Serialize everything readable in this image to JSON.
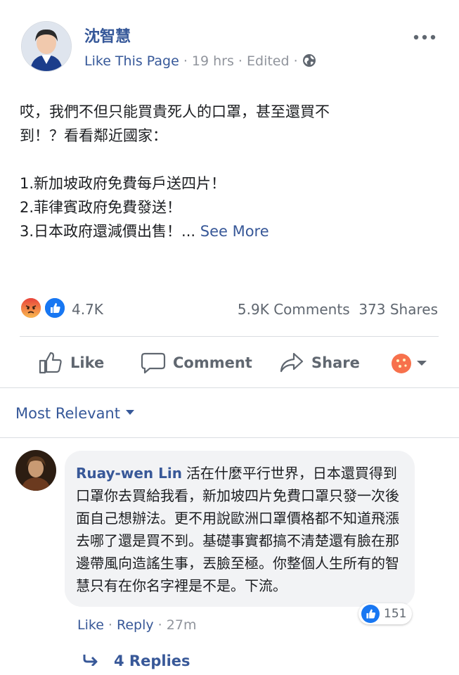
{
  "post": {
    "author": "沈智慧",
    "like_page": "Like This Page",
    "sep1": " · ",
    "time": "19 hrs",
    "sep2": " · ",
    "edited": "Edited",
    "sep3": " · ",
    "text_lines": [
      "哎，我們不但只能買貴死人的口罩，甚至還買不",
      "到！？看看鄰近國家：",
      "1.新加坡政府免費每戶送四片！",
      "2.菲律賓政府免費發送！",
      "3.日本政府還減價出售！..."
    ],
    "see_more": "See More",
    "reaction_count": "4.7K",
    "comments": "5.9K Comments",
    "shares": "373 Shares"
  },
  "actions": {
    "like": "Like",
    "comment": "Comment",
    "share": "Share"
  },
  "comments_section": {
    "sort_label": "Most Relevant",
    "comment": {
      "author": "Ruay-wen Lin",
      "text": "活在什麼平行世界，日本還買得到口罩你去買給我看，新加坡四片免費口罩只發一次後面自己想辦法。更不用說歐洲口罩價格都不知道飛漲去哪了還是買不到。基礎事實都搞不清楚還有臉在那邊帶風向造謠生事，丟臉至極。你整個人生所有的智慧只有在你名字裡是不是。下流。",
      "like_count": "151",
      "like_label": "Like",
      "sep1": " · ",
      "reply_label": "Reply",
      "sep2": " · ",
      "time": "27m",
      "replies_label": "4 Replies"
    }
  },
  "colors": {
    "link_blue": "#365899",
    "like_blue": "#1877f2",
    "angry_orange": "#f7714c",
    "meta_gray": "#90949c"
  },
  "icons": [
    "more-icon",
    "globe-icon",
    "angry-reaction-icon",
    "like-reaction-icon",
    "like-icon",
    "comment-icon",
    "share-icon",
    "reaction-picker-icon",
    "caret-down-icon",
    "reply-arrow-icon"
  ]
}
